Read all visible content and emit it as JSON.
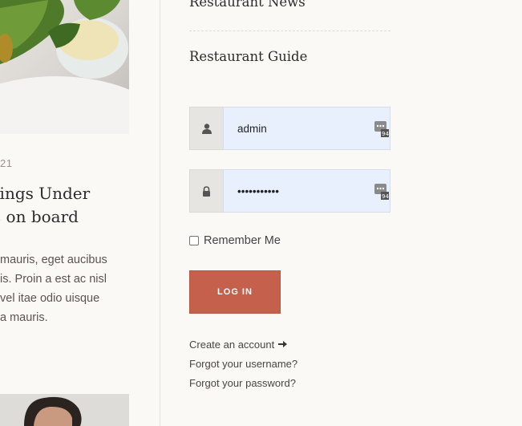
{
  "article": {
    "date": "21",
    "title_lines": [
      "rings Under",
      "c on board"
    ],
    "excerpt_lines": [
      "mauris, eget aucibus",
      "is. Proin a est ac nisl",
      "vel itae odio uisque",
      "a mauris."
    ]
  },
  "sidebar": {
    "news_link": "Restaurant News",
    "guide_link": "Restaurant Guide"
  },
  "login": {
    "username_value": "admin",
    "password_value": "•••••••••••",
    "remember_label": "Remember Me",
    "submit_label": "LOG IN",
    "create_account": "Create an account",
    "forgot_username": "Forgot your username?",
    "forgot_password": "Forgot your password?"
  },
  "icons": {
    "user": "user-icon",
    "lock": "lock-icon",
    "arrow": "arrow-right-icon",
    "password_manager": "password-manager-icon"
  },
  "colors": {
    "background": "#fbf9f5",
    "button": "#c4604b",
    "input_fill": "#e8f0fe"
  }
}
